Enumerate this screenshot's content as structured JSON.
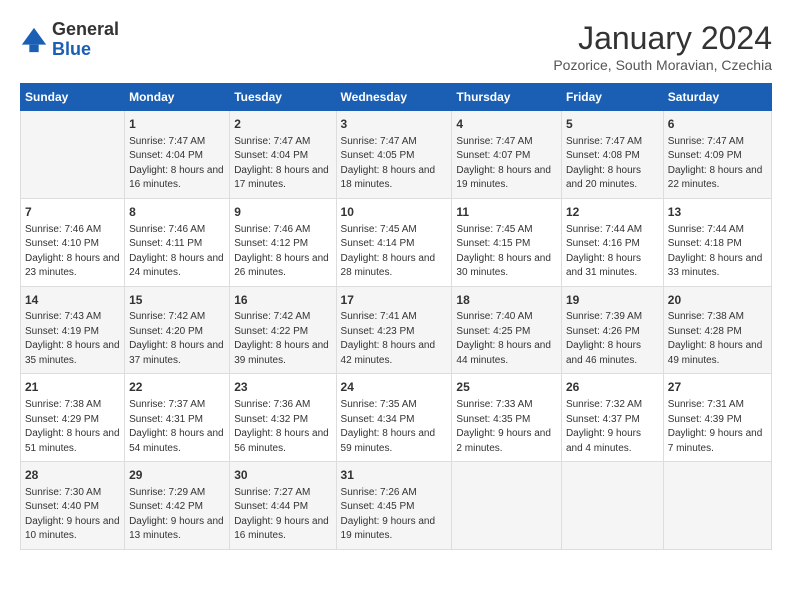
{
  "header": {
    "logo_general": "General",
    "logo_blue": "Blue",
    "month_title": "January 2024",
    "subtitle": "Pozorice, South Moravian, Czechia"
  },
  "days_of_week": [
    "Sunday",
    "Monday",
    "Tuesday",
    "Wednesday",
    "Thursday",
    "Friday",
    "Saturday"
  ],
  "weeks": [
    [
      {
        "day": "",
        "sunrise": "",
        "sunset": "",
        "daylight": ""
      },
      {
        "day": "1",
        "sunrise": "Sunrise: 7:47 AM",
        "sunset": "Sunset: 4:04 PM",
        "daylight": "Daylight: 8 hours and 16 minutes."
      },
      {
        "day": "2",
        "sunrise": "Sunrise: 7:47 AM",
        "sunset": "Sunset: 4:04 PM",
        "daylight": "Daylight: 8 hours and 17 minutes."
      },
      {
        "day": "3",
        "sunrise": "Sunrise: 7:47 AM",
        "sunset": "Sunset: 4:05 PM",
        "daylight": "Daylight: 8 hours and 18 minutes."
      },
      {
        "day": "4",
        "sunrise": "Sunrise: 7:47 AM",
        "sunset": "Sunset: 4:07 PM",
        "daylight": "Daylight: 8 hours and 19 minutes."
      },
      {
        "day": "5",
        "sunrise": "Sunrise: 7:47 AM",
        "sunset": "Sunset: 4:08 PM",
        "daylight": "Daylight: 8 hours and 20 minutes."
      },
      {
        "day": "6",
        "sunrise": "Sunrise: 7:47 AM",
        "sunset": "Sunset: 4:09 PM",
        "daylight": "Daylight: 8 hours and 22 minutes."
      }
    ],
    [
      {
        "day": "7",
        "sunrise": "Sunrise: 7:46 AM",
        "sunset": "Sunset: 4:10 PM",
        "daylight": "Daylight: 8 hours and 23 minutes."
      },
      {
        "day": "8",
        "sunrise": "Sunrise: 7:46 AM",
        "sunset": "Sunset: 4:11 PM",
        "daylight": "Daylight: 8 hours and 24 minutes."
      },
      {
        "day": "9",
        "sunrise": "Sunrise: 7:46 AM",
        "sunset": "Sunset: 4:12 PM",
        "daylight": "Daylight: 8 hours and 26 minutes."
      },
      {
        "day": "10",
        "sunrise": "Sunrise: 7:45 AM",
        "sunset": "Sunset: 4:14 PM",
        "daylight": "Daylight: 8 hours and 28 minutes."
      },
      {
        "day": "11",
        "sunrise": "Sunrise: 7:45 AM",
        "sunset": "Sunset: 4:15 PM",
        "daylight": "Daylight: 8 hours and 30 minutes."
      },
      {
        "day": "12",
        "sunrise": "Sunrise: 7:44 AM",
        "sunset": "Sunset: 4:16 PM",
        "daylight": "Daylight: 8 hours and 31 minutes."
      },
      {
        "day": "13",
        "sunrise": "Sunrise: 7:44 AM",
        "sunset": "Sunset: 4:18 PM",
        "daylight": "Daylight: 8 hours and 33 minutes."
      }
    ],
    [
      {
        "day": "14",
        "sunrise": "Sunrise: 7:43 AM",
        "sunset": "Sunset: 4:19 PM",
        "daylight": "Daylight: 8 hours and 35 minutes."
      },
      {
        "day": "15",
        "sunrise": "Sunrise: 7:42 AM",
        "sunset": "Sunset: 4:20 PM",
        "daylight": "Daylight: 8 hours and 37 minutes."
      },
      {
        "day": "16",
        "sunrise": "Sunrise: 7:42 AM",
        "sunset": "Sunset: 4:22 PM",
        "daylight": "Daylight: 8 hours and 39 minutes."
      },
      {
        "day": "17",
        "sunrise": "Sunrise: 7:41 AM",
        "sunset": "Sunset: 4:23 PM",
        "daylight": "Daylight: 8 hours and 42 minutes."
      },
      {
        "day": "18",
        "sunrise": "Sunrise: 7:40 AM",
        "sunset": "Sunset: 4:25 PM",
        "daylight": "Daylight: 8 hours and 44 minutes."
      },
      {
        "day": "19",
        "sunrise": "Sunrise: 7:39 AM",
        "sunset": "Sunset: 4:26 PM",
        "daylight": "Daylight: 8 hours and 46 minutes."
      },
      {
        "day": "20",
        "sunrise": "Sunrise: 7:38 AM",
        "sunset": "Sunset: 4:28 PM",
        "daylight": "Daylight: 8 hours and 49 minutes."
      }
    ],
    [
      {
        "day": "21",
        "sunrise": "Sunrise: 7:38 AM",
        "sunset": "Sunset: 4:29 PM",
        "daylight": "Daylight: 8 hours and 51 minutes."
      },
      {
        "day": "22",
        "sunrise": "Sunrise: 7:37 AM",
        "sunset": "Sunset: 4:31 PM",
        "daylight": "Daylight: 8 hours and 54 minutes."
      },
      {
        "day": "23",
        "sunrise": "Sunrise: 7:36 AM",
        "sunset": "Sunset: 4:32 PM",
        "daylight": "Daylight: 8 hours and 56 minutes."
      },
      {
        "day": "24",
        "sunrise": "Sunrise: 7:35 AM",
        "sunset": "Sunset: 4:34 PM",
        "daylight": "Daylight: 8 hours and 59 minutes."
      },
      {
        "day": "25",
        "sunrise": "Sunrise: 7:33 AM",
        "sunset": "Sunset: 4:35 PM",
        "daylight": "Daylight: 9 hours and 2 minutes."
      },
      {
        "day": "26",
        "sunrise": "Sunrise: 7:32 AM",
        "sunset": "Sunset: 4:37 PM",
        "daylight": "Daylight: 9 hours and 4 minutes."
      },
      {
        "day": "27",
        "sunrise": "Sunrise: 7:31 AM",
        "sunset": "Sunset: 4:39 PM",
        "daylight": "Daylight: 9 hours and 7 minutes."
      }
    ],
    [
      {
        "day": "28",
        "sunrise": "Sunrise: 7:30 AM",
        "sunset": "Sunset: 4:40 PM",
        "daylight": "Daylight: 9 hours and 10 minutes."
      },
      {
        "day": "29",
        "sunrise": "Sunrise: 7:29 AM",
        "sunset": "Sunset: 4:42 PM",
        "daylight": "Daylight: 9 hours and 13 minutes."
      },
      {
        "day": "30",
        "sunrise": "Sunrise: 7:27 AM",
        "sunset": "Sunset: 4:44 PM",
        "daylight": "Daylight: 9 hours and 16 minutes."
      },
      {
        "day": "31",
        "sunrise": "Sunrise: 7:26 AM",
        "sunset": "Sunset: 4:45 PM",
        "daylight": "Daylight: 9 hours and 19 minutes."
      },
      {
        "day": "",
        "sunrise": "",
        "sunset": "",
        "daylight": ""
      },
      {
        "day": "",
        "sunrise": "",
        "sunset": "",
        "daylight": ""
      },
      {
        "day": "",
        "sunrise": "",
        "sunset": "",
        "daylight": ""
      }
    ]
  ]
}
